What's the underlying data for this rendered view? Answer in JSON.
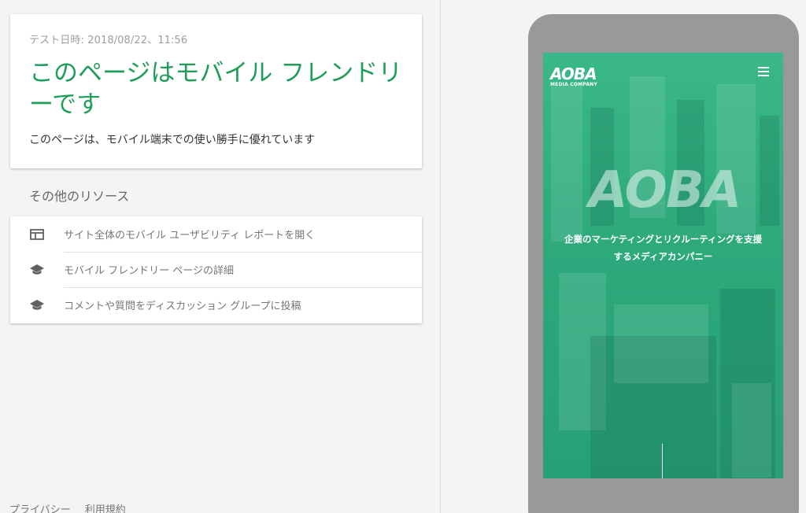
{
  "result": {
    "test_date": "テスト日時: 2018/08/22、11:56",
    "title": "このページはモバイル フレンドリーです",
    "description": "このページは、モバイル端末での使い勝手に優れています"
  },
  "resources": {
    "heading": "その他のリソース",
    "items": [
      {
        "icon": "report-icon",
        "label": "サイト全体のモバイル ユーザビリティ レポートを開く"
      },
      {
        "icon": "school-icon",
        "label": "モバイル フレンドリー ページの詳細"
      },
      {
        "icon": "school-icon",
        "label": "コメントや質問をディスカッション グループに投稿"
      }
    ]
  },
  "footer": {
    "privacy": "プライバシー",
    "terms": "利用規約"
  },
  "preview": {
    "logo_small": "AOBA",
    "logo_sub": "MEDIA COMPANY",
    "logo_big": "AOBA",
    "tagline_line1": "企業のマーケティングとリクルーティングを支援",
    "tagline_line2": "するメディアカンパニー",
    "menu_icon": "hamburger-menu-icon",
    "accent_color": "#2eaa7d"
  },
  "colors": {
    "title_green": "#1e9e5a",
    "phone_frame": "#999999"
  }
}
